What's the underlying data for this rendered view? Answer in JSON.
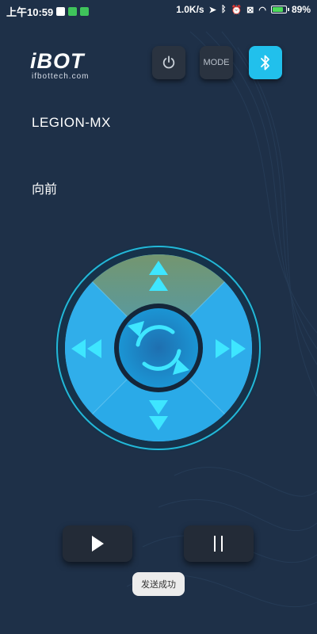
{
  "status_bar": {
    "time": "上午10:59",
    "network_speed": "1.0K/s",
    "battery_percent": "89%",
    "battery_level": 0.89
  },
  "logo": {
    "text": "iBOT",
    "subtitle": "ifbottech.com"
  },
  "top_buttons": {
    "mode_label": "MODE"
  },
  "device_name": "LEGION-MX",
  "direction_label": "向前",
  "toast_message": "发送成功",
  "colors": {
    "background": "#1e3048",
    "accent_cyan": "#21c0ec",
    "pad_blue": "#2aa7e6",
    "pad_active_top": "#6f9a7d",
    "button_dark": "#2a3340",
    "arrow_cyan": "#36e4ff"
  },
  "icons": {
    "power": "power-icon",
    "bluetooth": "bluetooth-icon",
    "up": "arrow-up-double-icon",
    "down": "arrow-down-double-icon",
    "left": "arrow-left-double-icon",
    "right": "arrow-right-double-icon",
    "rotate": "rotate-icon",
    "play": "play-icon",
    "pause": "pause-icon"
  }
}
